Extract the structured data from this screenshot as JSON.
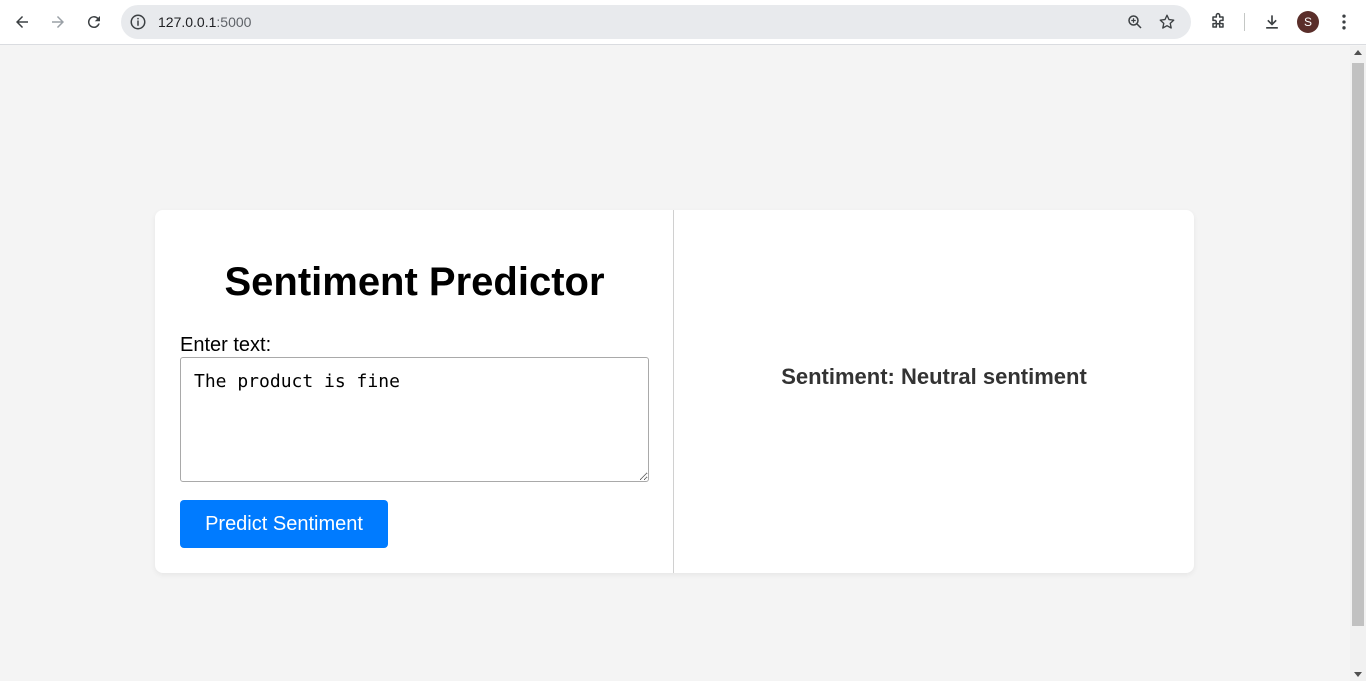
{
  "browser": {
    "url_host": "127.0.0.1",
    "url_port": ":5000",
    "avatar_letter": "S"
  },
  "page": {
    "title": "Sentiment Predictor",
    "input_label": "Enter text:",
    "input_value": "The product is fine",
    "button_label": "Predict Sentiment",
    "result_text": "Sentiment: Neutral sentiment"
  },
  "colors": {
    "button": "#007bff",
    "page_bg": "#f4f4f4",
    "card_bg": "#ffffff"
  }
}
